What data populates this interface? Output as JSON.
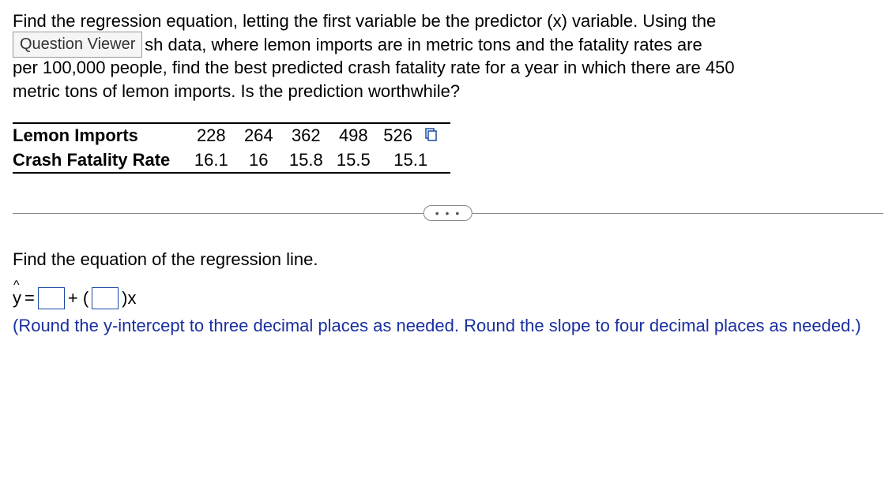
{
  "question": {
    "line1": "Find the regression equation, letting the first variable be the predictor (x) variable. Using the",
    "line2a": "listed lemon/crash data, where lemon imports are in metric tons and the fatality rates are",
    "line2b_prefix": "sh data, where lemon imports are in metric tons and the fatality rates are",
    "line3_prefix": "per 100,000 people, find the best predicted crash fatality rate for a year in which there are 450",
    "line3_obscured": "per 100,000 people, find the best predicted crash fatality rate for a year in which there are 450",
    "line4": "metric tons of lemon imports. Is the prediction worthwhile?"
  },
  "question_viewer_label": "Question Viewer",
  "table": {
    "rows": [
      {
        "label": "Lemon Imports",
        "values": [
          "228",
          "264",
          "362",
          "498",
          "526"
        ]
      },
      {
        "label": "Crash Fatality Rate",
        "values": [
          "16.1",
          "16",
          "15.8",
          "15.5",
          "15.1"
        ]
      }
    ]
  },
  "divider_dots": "• • •",
  "prompt": "Find the equation of the regression line.",
  "equation": {
    "y": "y",
    "equals": " = ",
    "plus": " + (",
    "xclose": ")x"
  },
  "instruction": "(Round the y-intercept to three decimal places as needed. Round the slope to four decimal places as needed.)",
  "chart_data": {
    "type": "table",
    "categories": [
      "228",
      "264",
      "362",
      "498",
      "526"
    ],
    "series": [
      {
        "name": "Lemon Imports",
        "values": [
          228,
          264,
          362,
          498,
          526
        ]
      },
      {
        "name": "Crash Fatality Rate",
        "values": [
          16.1,
          16,
          15.8,
          15.5,
          15.1
        ]
      }
    ]
  }
}
